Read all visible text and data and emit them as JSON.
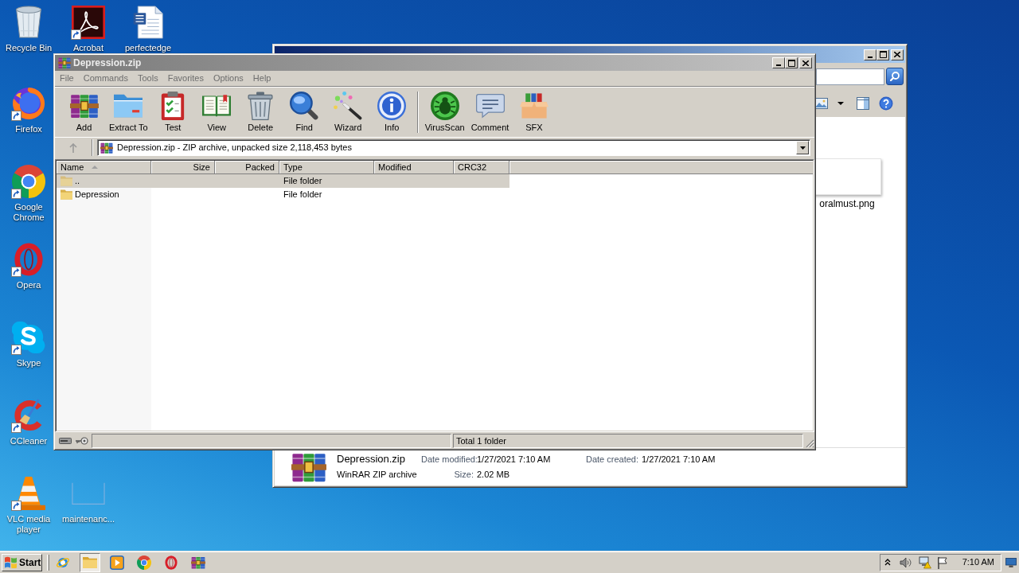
{
  "desktop_icons": [
    {
      "label": "Recycle Bin",
      "kind": "bin",
      "shortcut": false
    },
    {
      "label": "Acrobat",
      "kind": "swoosh",
      "shortcut": true
    },
    {
      "label": "perfectedge",
      "kind": "document",
      "shortcut": false
    },
    {
      "label": "Firefox",
      "kind": "globe",
      "shortcut": true
    },
    {
      "label": "Google Chrome",
      "kind": "wheel",
      "shortcut": true
    },
    {
      "label": "Opera",
      "kind": "ring",
      "shortcut": true
    },
    {
      "label": "Skype",
      "kind": "cloud",
      "shortcut": true
    },
    {
      "label": "CCleaner",
      "kind": "brush",
      "shortcut": true
    },
    {
      "label": "VLC media player",
      "kind": "cone",
      "shortcut": true
    },
    {
      "label": "maintenanc...",
      "kind": "blank",
      "shortcut": false
    }
  ],
  "explorer_window": {
    "active": true,
    "files": [
      {
        "name": "oralmust.png"
      }
    ],
    "details": {
      "lines": [
        {
          "title": "Depression.zip",
          "fields": [
            {
              "label": "Date modified:",
              "value": "1/27/2021 7:10 AM"
            },
            {
              "label": "Date created:",
              "value": "1/27/2021 7:10 AM"
            }
          ]
        },
        {
          "title": "WinRAR ZIP archive",
          "fields": [
            {
              "label": "Size:",
              "value": "2.02 MB"
            }
          ]
        }
      ]
    }
  },
  "winrar_window": {
    "title": "Depression.zip",
    "active": false,
    "menu": [
      "File",
      "Commands",
      "Tools",
      "Favorites",
      "Options",
      "Help"
    ],
    "toolbar_groups": [
      [
        {
          "label": "Add",
          "kind": "add"
        },
        {
          "label": "Extract To",
          "kind": "extract"
        },
        {
          "label": "Test",
          "kind": "test"
        },
        {
          "label": "View",
          "kind": "view"
        },
        {
          "label": "Delete",
          "kind": "delete"
        },
        {
          "label": "Find",
          "kind": "find"
        },
        {
          "label": "Wizard",
          "kind": "wizard"
        },
        {
          "label": "Info",
          "kind": "info"
        }
      ],
      [
        {
          "label": "VirusScan",
          "kind": "virusscan"
        },
        {
          "label": "Comment",
          "kind": "comment"
        },
        {
          "label": "SFX",
          "kind": "sfx"
        }
      ]
    ],
    "up_button": {
      "disabled": true
    },
    "address": "Depression.zip - ZIP archive, unpacked size 2,118,453 bytes",
    "columns": [
      {
        "label": "Name",
        "kind": "text",
        "sorted": true
      },
      {
        "label": "Size",
        "kind": "number",
        "sorted": false
      },
      {
        "label": "Packed",
        "kind": "number",
        "sorted": false
      },
      {
        "label": "Type",
        "kind": "text",
        "sorted": false
      },
      {
        "label": "Modified",
        "kind": "text",
        "sorted": false
      },
      {
        "label": "CRC32",
        "kind": "text",
        "sorted": false
      }
    ],
    "rows": [
      {
        "name": "..",
        "type": "File folder",
        "selected": true
      },
      {
        "name": "Depression",
        "type": "File folder",
        "selected": false
      }
    ],
    "status": "Total 1 folder"
  },
  "taskbar": {
    "start": "Start",
    "apps": [
      {
        "kind": "globe-ring",
        "selected": false
      },
      {
        "kind": "folder",
        "selected": true
      },
      {
        "kind": "play",
        "selected": false
      },
      {
        "kind": "wheel",
        "selected": false
      },
      {
        "kind": "ring",
        "selected": false
      },
      {
        "kind": "archive",
        "selected": false
      }
    ],
    "clock": "7:10 AM"
  }
}
